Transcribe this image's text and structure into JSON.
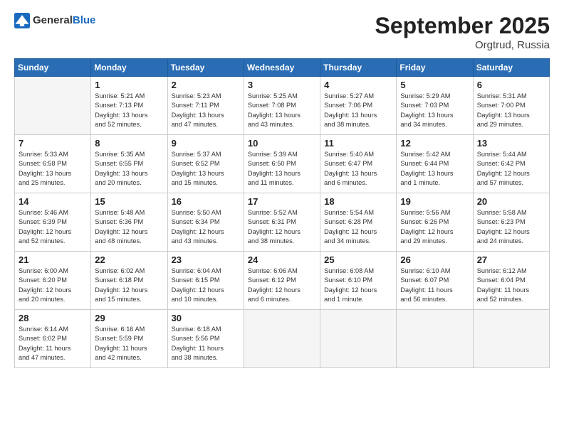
{
  "header": {
    "logo_general": "General",
    "logo_blue": "Blue",
    "title": "September 2025",
    "location": "Orgtrud, Russia"
  },
  "days_of_week": [
    "Sunday",
    "Monday",
    "Tuesday",
    "Wednesday",
    "Thursday",
    "Friday",
    "Saturday"
  ],
  "weeks": [
    [
      {
        "day": "",
        "info": ""
      },
      {
        "day": "1",
        "info": "Sunrise: 5:21 AM\nSunset: 7:13 PM\nDaylight: 13 hours\nand 52 minutes."
      },
      {
        "day": "2",
        "info": "Sunrise: 5:23 AM\nSunset: 7:11 PM\nDaylight: 13 hours\nand 47 minutes."
      },
      {
        "day": "3",
        "info": "Sunrise: 5:25 AM\nSunset: 7:08 PM\nDaylight: 13 hours\nand 43 minutes."
      },
      {
        "day": "4",
        "info": "Sunrise: 5:27 AM\nSunset: 7:06 PM\nDaylight: 13 hours\nand 38 minutes."
      },
      {
        "day": "5",
        "info": "Sunrise: 5:29 AM\nSunset: 7:03 PM\nDaylight: 13 hours\nand 34 minutes."
      },
      {
        "day": "6",
        "info": "Sunrise: 5:31 AM\nSunset: 7:00 PM\nDaylight: 13 hours\nand 29 minutes."
      }
    ],
    [
      {
        "day": "7",
        "info": "Sunrise: 5:33 AM\nSunset: 6:58 PM\nDaylight: 13 hours\nand 25 minutes."
      },
      {
        "day": "8",
        "info": "Sunrise: 5:35 AM\nSunset: 6:55 PM\nDaylight: 13 hours\nand 20 minutes."
      },
      {
        "day": "9",
        "info": "Sunrise: 5:37 AM\nSunset: 6:52 PM\nDaylight: 13 hours\nand 15 minutes."
      },
      {
        "day": "10",
        "info": "Sunrise: 5:39 AM\nSunset: 6:50 PM\nDaylight: 13 hours\nand 11 minutes."
      },
      {
        "day": "11",
        "info": "Sunrise: 5:40 AM\nSunset: 6:47 PM\nDaylight: 13 hours\nand 6 minutes."
      },
      {
        "day": "12",
        "info": "Sunrise: 5:42 AM\nSunset: 6:44 PM\nDaylight: 13 hours\nand 1 minute."
      },
      {
        "day": "13",
        "info": "Sunrise: 5:44 AM\nSunset: 6:42 PM\nDaylight: 12 hours\nand 57 minutes."
      }
    ],
    [
      {
        "day": "14",
        "info": "Sunrise: 5:46 AM\nSunset: 6:39 PM\nDaylight: 12 hours\nand 52 minutes."
      },
      {
        "day": "15",
        "info": "Sunrise: 5:48 AM\nSunset: 6:36 PM\nDaylight: 12 hours\nand 48 minutes."
      },
      {
        "day": "16",
        "info": "Sunrise: 5:50 AM\nSunset: 6:34 PM\nDaylight: 12 hours\nand 43 minutes."
      },
      {
        "day": "17",
        "info": "Sunrise: 5:52 AM\nSunset: 6:31 PM\nDaylight: 12 hours\nand 38 minutes."
      },
      {
        "day": "18",
        "info": "Sunrise: 5:54 AM\nSunset: 6:28 PM\nDaylight: 12 hours\nand 34 minutes."
      },
      {
        "day": "19",
        "info": "Sunrise: 5:56 AM\nSunset: 6:26 PM\nDaylight: 12 hours\nand 29 minutes."
      },
      {
        "day": "20",
        "info": "Sunrise: 5:58 AM\nSunset: 6:23 PM\nDaylight: 12 hours\nand 24 minutes."
      }
    ],
    [
      {
        "day": "21",
        "info": "Sunrise: 6:00 AM\nSunset: 6:20 PM\nDaylight: 12 hours\nand 20 minutes."
      },
      {
        "day": "22",
        "info": "Sunrise: 6:02 AM\nSunset: 6:18 PM\nDaylight: 12 hours\nand 15 minutes."
      },
      {
        "day": "23",
        "info": "Sunrise: 6:04 AM\nSunset: 6:15 PM\nDaylight: 12 hours\nand 10 minutes."
      },
      {
        "day": "24",
        "info": "Sunrise: 6:06 AM\nSunset: 6:12 PM\nDaylight: 12 hours\nand 6 minutes."
      },
      {
        "day": "25",
        "info": "Sunrise: 6:08 AM\nSunset: 6:10 PM\nDaylight: 12 hours\nand 1 minute."
      },
      {
        "day": "26",
        "info": "Sunrise: 6:10 AM\nSunset: 6:07 PM\nDaylight: 11 hours\nand 56 minutes."
      },
      {
        "day": "27",
        "info": "Sunrise: 6:12 AM\nSunset: 6:04 PM\nDaylight: 11 hours\nand 52 minutes."
      }
    ],
    [
      {
        "day": "28",
        "info": "Sunrise: 6:14 AM\nSunset: 6:02 PM\nDaylight: 11 hours\nand 47 minutes."
      },
      {
        "day": "29",
        "info": "Sunrise: 6:16 AM\nSunset: 5:59 PM\nDaylight: 11 hours\nand 42 minutes."
      },
      {
        "day": "30",
        "info": "Sunrise: 6:18 AM\nSunset: 5:56 PM\nDaylight: 11 hours\nand 38 minutes."
      },
      {
        "day": "",
        "info": ""
      },
      {
        "day": "",
        "info": ""
      },
      {
        "day": "",
        "info": ""
      },
      {
        "day": "",
        "info": ""
      }
    ]
  ]
}
